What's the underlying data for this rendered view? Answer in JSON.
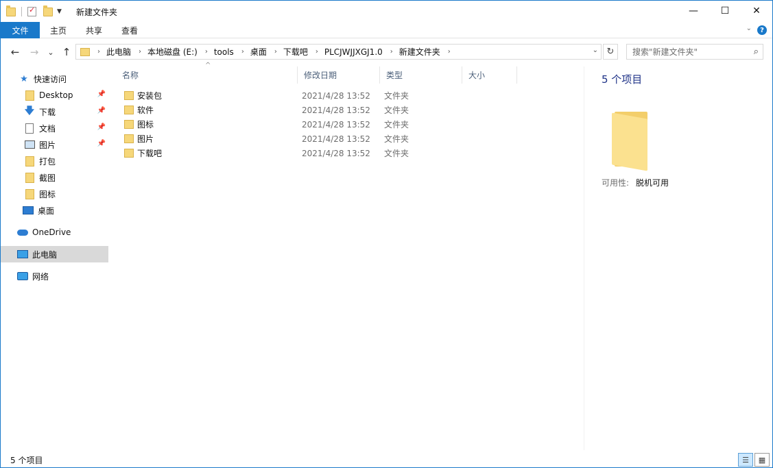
{
  "window": {
    "title": "新建文件夹",
    "minimize_glyph": "—",
    "maximize_glyph": "☐",
    "close_glyph": "✕"
  },
  "ribbon": {
    "tabs": [
      "文件",
      "主页",
      "共享",
      "查看"
    ],
    "help_glyph": "?",
    "collapse_glyph": "⌄"
  },
  "nav": {
    "back_glyph": "←",
    "forward_glyph": "→",
    "recent_glyph": "⌄",
    "up_glyph": "↑",
    "breadcrumb": [
      "此电脑",
      "本地磁盘 (E:)",
      "tools",
      "桌面",
      "下载吧",
      "PLCJWJJXGJ1.0",
      "新建文件夹"
    ],
    "breadcrumb_sep": "›",
    "dropdown_glyph": "⌄",
    "refresh_glyph": "↻",
    "search_placeholder": "搜索\"新建文件夹\"",
    "search_icon_glyph": "⌕"
  },
  "sidebar": {
    "quick_access": "快速访问",
    "items": [
      {
        "label": "Desktop",
        "icon": "folder-icon",
        "pinned": true
      },
      {
        "label": "下载",
        "icon": "download-icon",
        "pinned": true
      },
      {
        "label": "文档",
        "icon": "document-icon",
        "pinned": true
      },
      {
        "label": "图片",
        "icon": "picture-icon",
        "pinned": true
      },
      {
        "label": "打包",
        "icon": "folder-icon",
        "pinned": false
      },
      {
        "label": "截图",
        "icon": "folder-icon",
        "pinned": false
      },
      {
        "label": "图标",
        "icon": "folder-icon",
        "pinned": false
      },
      {
        "label": "桌面",
        "icon": "desktop-icon",
        "pinned": false
      }
    ],
    "onedrive": "OneDrive",
    "this_pc": "此电脑",
    "network": "网络",
    "pin_glyph": "📌",
    "star_glyph": "★",
    "download_glyph": "🡇"
  },
  "file_list": {
    "sort_glyph": "^",
    "columns": [
      "名称",
      "修改日期",
      "类型",
      "大小"
    ],
    "rows": [
      {
        "name": "安装包",
        "date": "2021/4/28 13:52",
        "type": "文件夹"
      },
      {
        "name": "软件",
        "date": "2021/4/28 13:52",
        "type": "文件夹"
      },
      {
        "name": "图标",
        "date": "2021/4/28 13:52",
        "type": "文件夹"
      },
      {
        "name": "图片",
        "date": "2021/4/28 13:52",
        "type": "文件夹"
      },
      {
        "name": "下载吧",
        "date": "2021/4/28 13:52",
        "type": "文件夹"
      }
    ]
  },
  "preview": {
    "count": "5 个项目",
    "availability_label": "可用性:",
    "availability_value": "脱机可用"
  },
  "status": {
    "count": "5 个项目",
    "details_view_glyph": "☰",
    "large_icons_glyph": "▦"
  }
}
